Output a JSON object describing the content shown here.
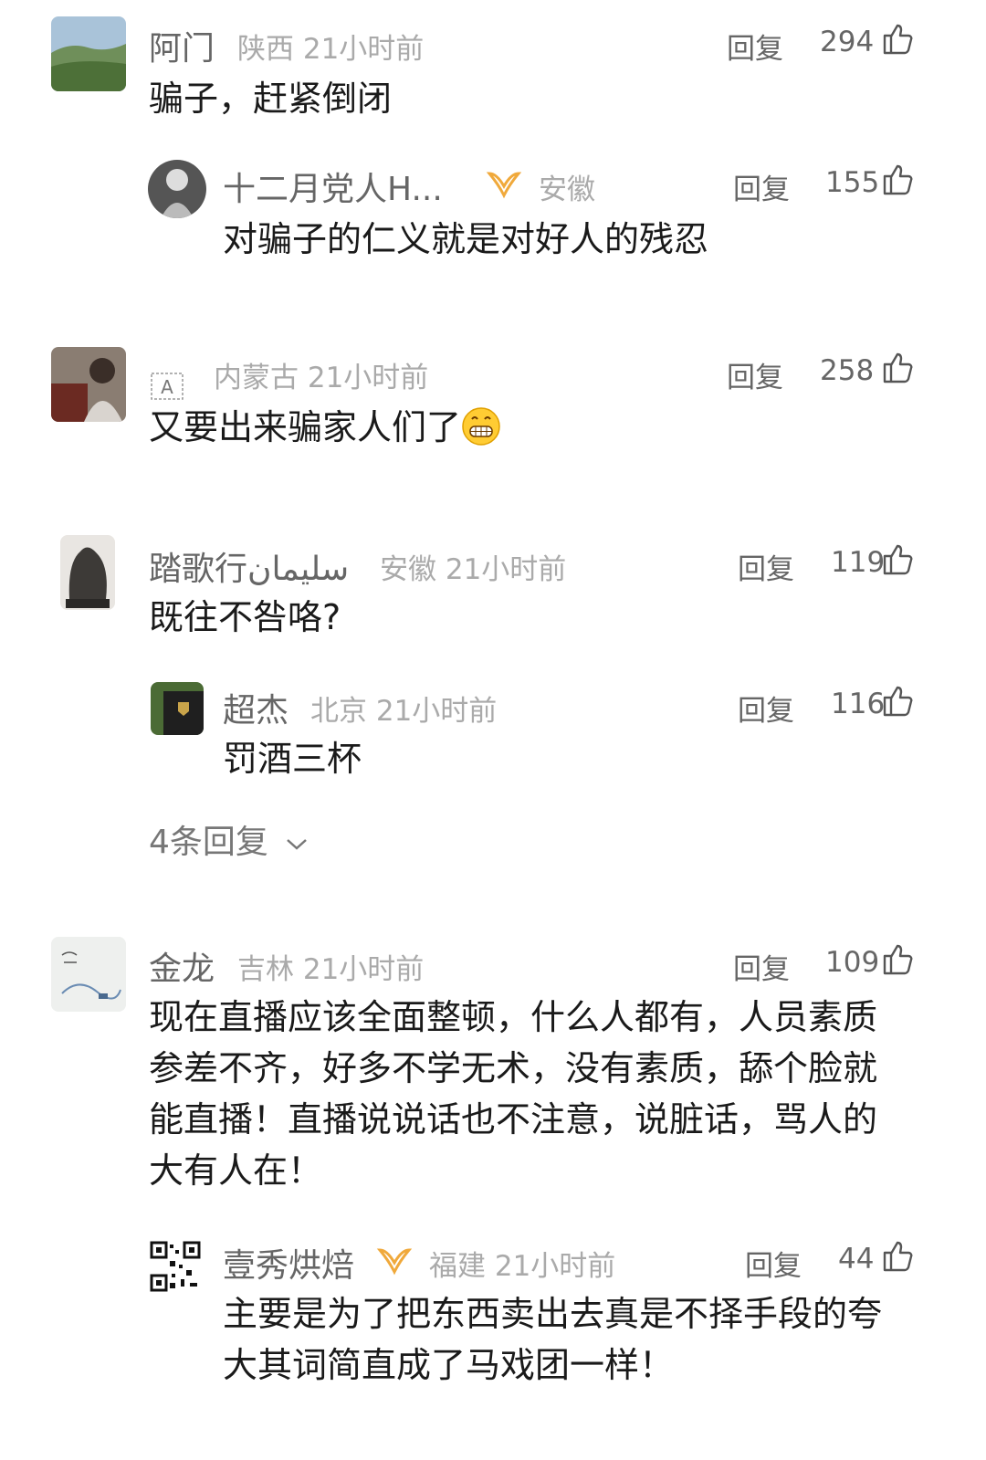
{
  "comments": [
    {
      "name": "阿门",
      "meta": "陕西 21小时前",
      "reply": "回复",
      "likes": "294",
      "text": "骗子，赶紧倒闭",
      "avatar": "mountain-landscape-avatar"
    },
    {
      "name": "十二月党人H...",
      "meta": "安徽",
      "reply": "回复",
      "likes": "155",
      "text": "对骗子的仁义就是对好人的残忍",
      "avatar": "cat-avatar"
    },
    {
      "name": "",
      "name_icon": "translate-a-icon",
      "meta": "内蒙古 21小时前",
      "reply": "回复",
      "likes": "258",
      "text": "又要出来骗家人们了",
      "emoji": "grinning-face-emoji",
      "avatar": "person-photo-avatar"
    },
    {
      "name": "踏歌行سليمان",
      "meta": "安徽 21小时前",
      "reply": "回复",
      "likes": "119",
      "text": "既往不咎咯?",
      "avatar": "stone-sculpture-avatar"
    },
    {
      "name": "超杰",
      "meta": "北京 21小时前",
      "reply": "回复",
      "likes": "116",
      "text": "罚酒三杯",
      "avatar": "car-badge-avatar"
    },
    {
      "name": "金龙",
      "meta": "吉林 21小时前",
      "reply": "回复",
      "likes": "109",
      "text": "现在直播应该全面整顿，什么人都有，人员素质参差不齐，好多不学无术，没有素质，舔个脸就能直播！直播说说话也不注意，说脏话，骂人的大有人在！",
      "avatar": "ink-painting-avatar"
    },
    {
      "name": "壹秀烘焙",
      "meta": "福建 21小时前",
      "reply": "回复",
      "likes": "44",
      "text": "主要是为了把东西卖出去真是不择手段的夸大其词简直成了马戏团一样！",
      "avatar": "qr-code-avatar"
    }
  ],
  "more_replies": "4条回复",
  "colors": {
    "vip_badge": "#f0a93b",
    "meta": "#aaaaaa",
    "text": "#1a1a1a"
  }
}
